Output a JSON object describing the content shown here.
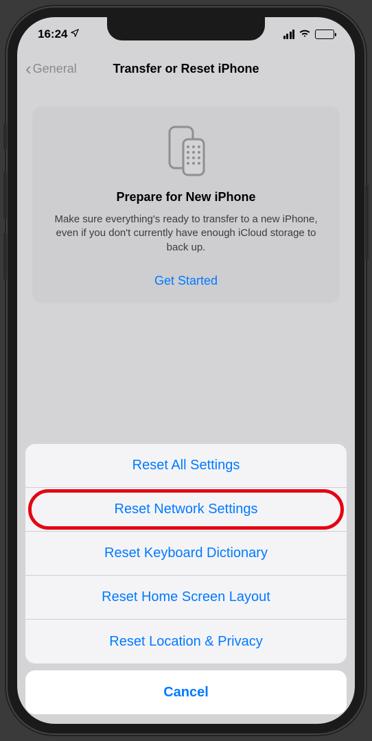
{
  "statusBar": {
    "time": "16:24"
  },
  "nav": {
    "back": "General",
    "title": "Transfer or Reset iPhone"
  },
  "prepareCard": {
    "title": "Prepare for New iPhone",
    "description": "Make sure everything's ready to transfer to a new iPhone, even if you don't currently have enough iCloud storage to back up.",
    "cta": "Get Started"
  },
  "actionSheet": {
    "items": [
      {
        "label": "Reset All Settings"
      },
      {
        "label": "Reset Network Settings"
      },
      {
        "label": "Reset Keyboard Dictionary"
      },
      {
        "label": "Reset Home Screen Layout"
      },
      {
        "label": "Reset Location & Privacy"
      }
    ],
    "cancel": "Cancel"
  }
}
